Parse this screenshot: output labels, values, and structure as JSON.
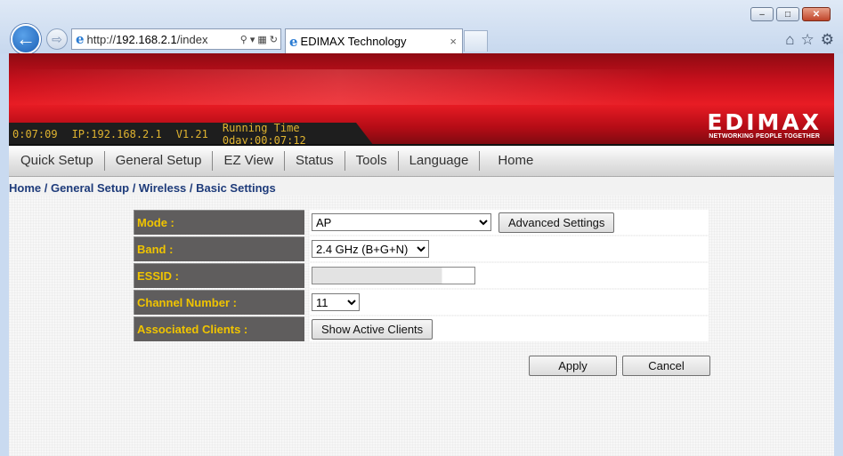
{
  "browser": {
    "url_prefix": "http://",
    "url_host": "192.168.2.1",
    "url_suffix": "/index",
    "tab_title": "EDIMAX Technology",
    "tab_close": "×",
    "minimize": "–",
    "maximize": "□",
    "close": "✕"
  },
  "status": {
    "time": "0:07:09",
    "ip": "IP:192.168.2.1",
    "version": "V1.21",
    "running_time": "Running Time 0day:00:07:12"
  },
  "logo": {
    "word": "EDIMAX",
    "tagline": "NETWORKING PEOPLE TOGETHER"
  },
  "menu": [
    "Quick Setup",
    "General Setup",
    "EZ View",
    "Status",
    "Tools",
    "Language",
    "Home"
  ],
  "breadcrumb": "Home / General Setup / Wireless / Basic Settings",
  "form": {
    "mode_label": "Mode :",
    "mode_value": "AP",
    "advanced_button": "Advanced Settings",
    "band_label": "Band :",
    "band_value": "2.4 GHz (B+G+N)",
    "essid_label": "ESSID :",
    "essid_value": "",
    "channel_label": "Channel Number :",
    "channel_value": "11",
    "clients_label": "Associated Clients :",
    "clients_button": "Show Active Clients"
  },
  "actions": {
    "apply": "Apply",
    "cancel": "Cancel"
  },
  "colors": {
    "label_bg": "#5f5d5d",
    "label_text": "#f0c400",
    "banner_red": "#e81c24",
    "breadcrumb": "#1e3b7a"
  }
}
